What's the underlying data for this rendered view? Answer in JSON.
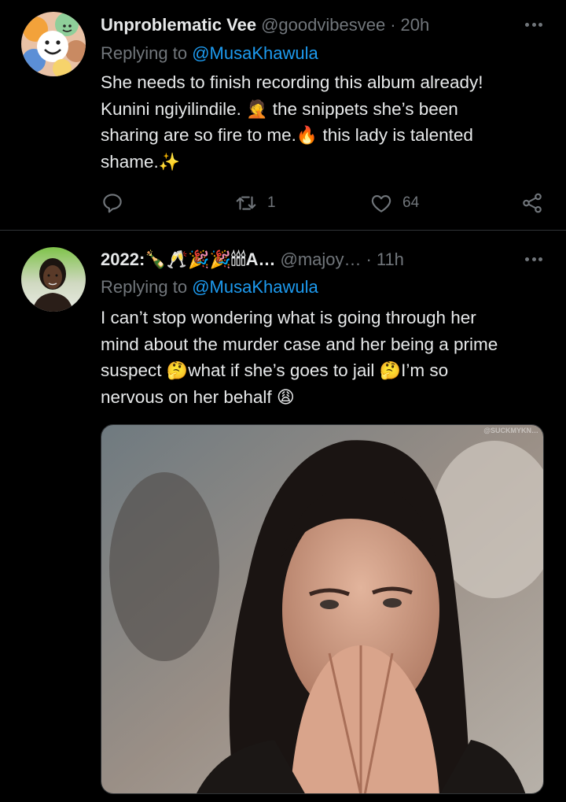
{
  "tweets": [
    {
      "display_name": "Unproblematic Vee",
      "handle": "@goodvibesvee",
      "separator": "·",
      "time": "20h",
      "replying_prefix": "Replying to",
      "replying_to": "@MusaKhawula",
      "lines": [
        [
          "She needs to finish recording this album already!"
        ],
        [
          "Kunini ngiyilindile.",
          "🤦",
          " the snippets she’s been"
        ],
        [
          "sharing are so fire to me.",
          "🔥",
          " this lady is talented"
        ],
        [
          "shame.",
          "✨"
        ]
      ],
      "reply_count": "",
      "retweet_count": "1",
      "like_count": "64",
      "avatar_icon": "smiley-faces-icon"
    },
    {
      "display_name": "2022:🍾🥂🎉🎉🕯🕯🕯A…",
      "handle": "@majoy…",
      "separator": "·",
      "time": "11h",
      "replying_prefix": "Replying to",
      "replying_to": "@MusaKhawula",
      "lines": [
        [
          "I can’t stop wondering what is going through her"
        ],
        [
          "mind about the murder case and her being a prime"
        ],
        [
          "suspect ",
          "🤔",
          "what if she’s goes to jail ",
          "🤔",
          "I’m so"
        ],
        [
          "nervous on her behalf ",
          "😩"
        ]
      ],
      "media_watermark": "@SUCKMYKN…",
      "avatar_icon": "profile-photo-icon"
    }
  ],
  "colors": {
    "background": "#000000",
    "primary_text": "#e7e9ea",
    "secondary_text": "#71767b",
    "accent": "#1d9bf0",
    "divider": "#2f3336"
  }
}
